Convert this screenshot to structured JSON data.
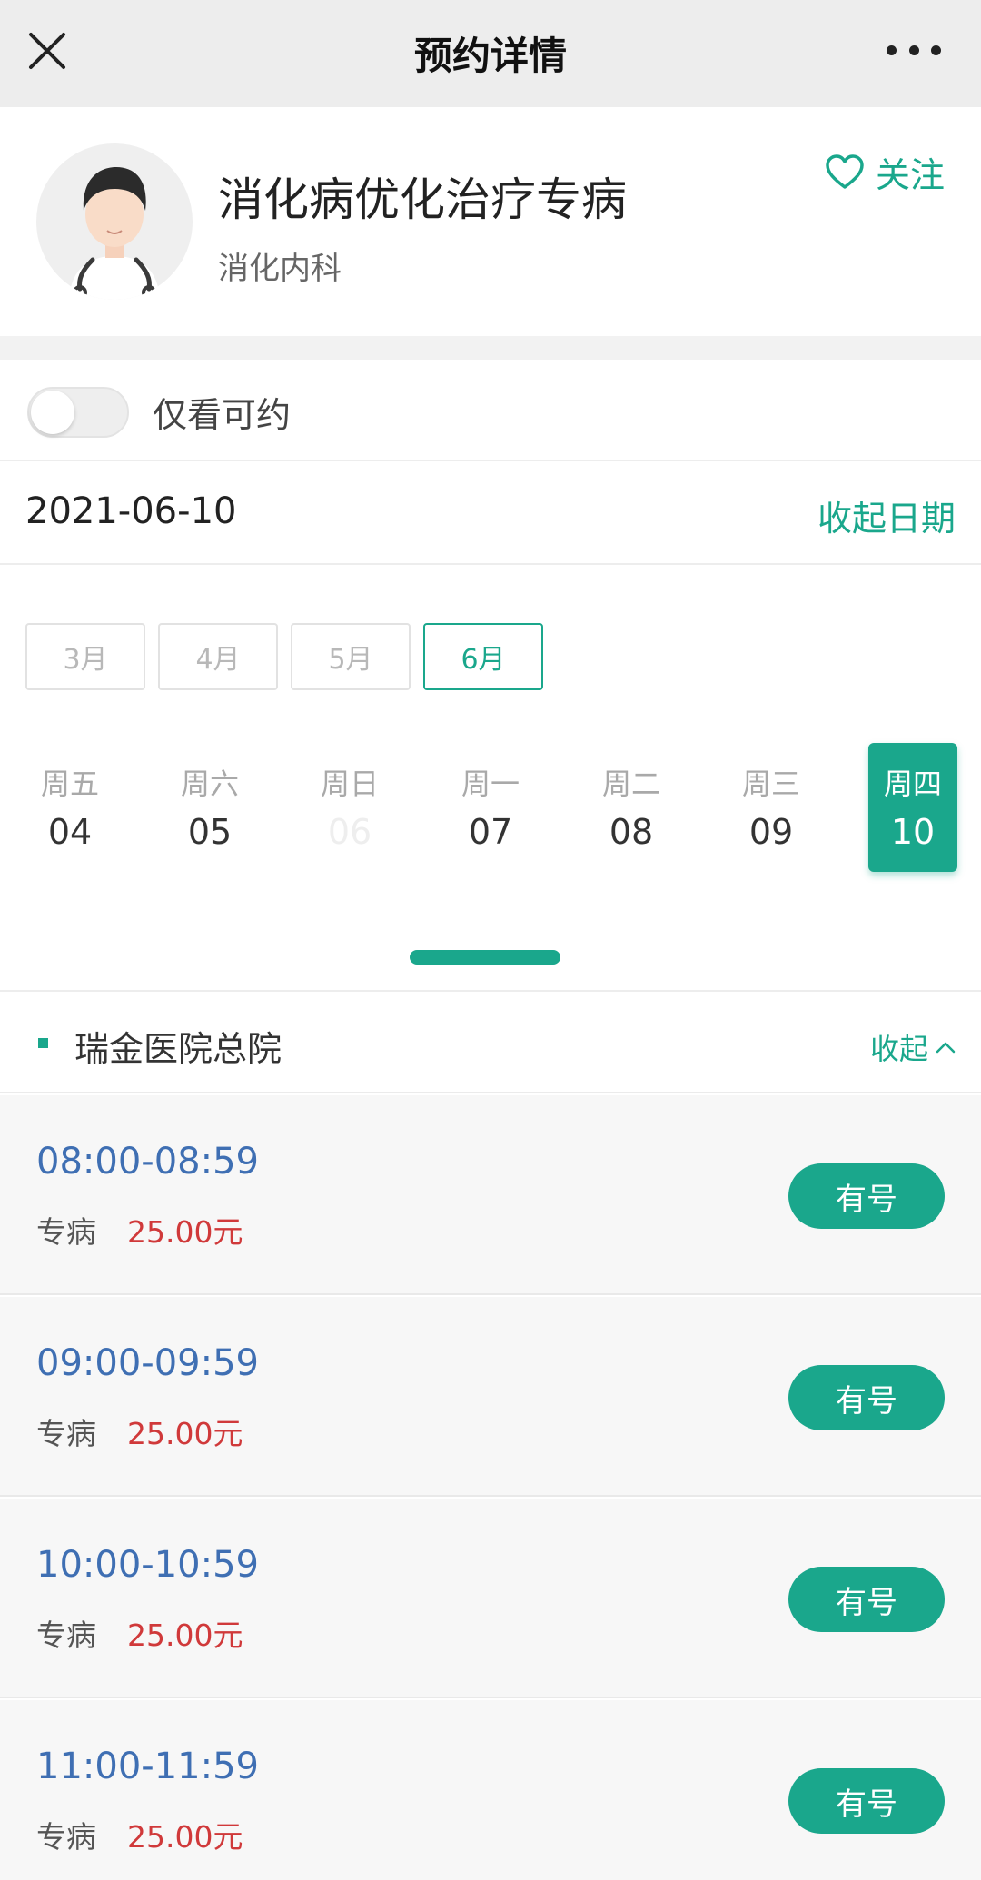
{
  "header": {
    "title": "预约详情",
    "close_icon": "close-icon",
    "more_icon": "more-dots-icon"
  },
  "doctor": {
    "name": "消化病优化治疗专病",
    "department": "消化内科",
    "follow_label": "关注",
    "avatar_icon": "doctor-avatar-icon"
  },
  "filter": {
    "only_available_label": "仅看可约",
    "only_available_on": false
  },
  "date_bar": {
    "selected_date": "2021-06-10",
    "collapse_label": "收起日期"
  },
  "months": [
    {
      "label": "3月",
      "active": false
    },
    {
      "label": "4月",
      "active": false
    },
    {
      "label": "5月",
      "active": false
    },
    {
      "label": "6月",
      "active": true
    }
  ],
  "days": [
    {
      "weekday": "周五",
      "day": "04",
      "state": "normal"
    },
    {
      "weekday": "周六",
      "day": "05",
      "state": "normal"
    },
    {
      "weekday": "周日",
      "day": "06",
      "state": "disabled"
    },
    {
      "weekday": "周一",
      "day": "07",
      "state": "normal"
    },
    {
      "weekday": "周二",
      "day": "08",
      "state": "normal"
    },
    {
      "weekday": "周三",
      "day": "09",
      "state": "normal"
    },
    {
      "weekday": "周四",
      "day": "10",
      "state": "selected"
    }
  ],
  "hospital": {
    "name": "瑞金医院总院",
    "collapse_label": "收起"
  },
  "slots": [
    {
      "time": "08:00-08:59",
      "type": "专病",
      "price": "25.00元",
      "button": "有号"
    },
    {
      "time": "09:00-09:59",
      "type": "专病",
      "price": "25.00元",
      "button": "有号"
    },
    {
      "time": "10:00-10:59",
      "type": "专病",
      "price": "25.00元",
      "button": "有号"
    },
    {
      "time": "11:00-11:59",
      "type": "专病",
      "price": "25.00元",
      "button": "有号"
    }
  ],
  "colors": {
    "accent": "#1aa78c",
    "time": "#3f6fb3",
    "price": "#d0393a"
  }
}
